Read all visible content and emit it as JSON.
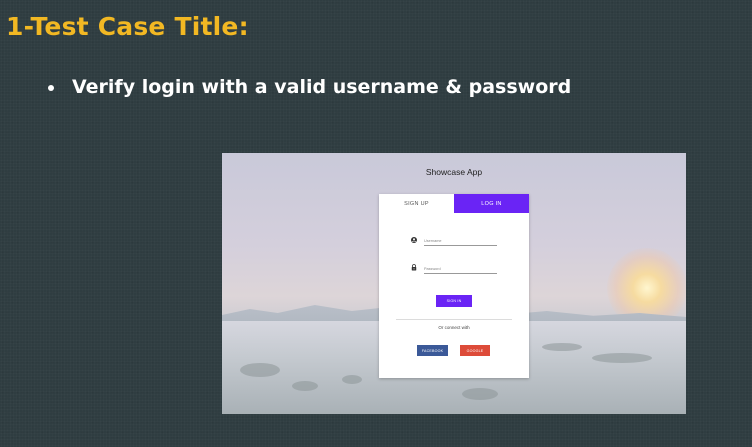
{
  "slide": {
    "title": "1-Test Case Title:",
    "bullet": "Verify login with a valid username & password"
  },
  "app": {
    "title": "Showcase App",
    "tabs": [
      {
        "label": "SIGN UP",
        "active": false
      },
      {
        "label": "LOG IN",
        "active": true
      }
    ],
    "username_placeholder": "Username",
    "password_placeholder": "Password",
    "signin_label": "SIGN IN",
    "connect_text": "Or connect with",
    "facebook_label": "FACEBOOK",
    "google_label": "GOOGLE"
  },
  "colors": {
    "slide_background": "#2f3d41",
    "title": "#f2b823",
    "accent": "#6a24f5",
    "facebook": "#3b5998",
    "google": "#dd4b39"
  },
  "icons": {
    "username": "account-circle-icon",
    "password": "lock-icon"
  }
}
